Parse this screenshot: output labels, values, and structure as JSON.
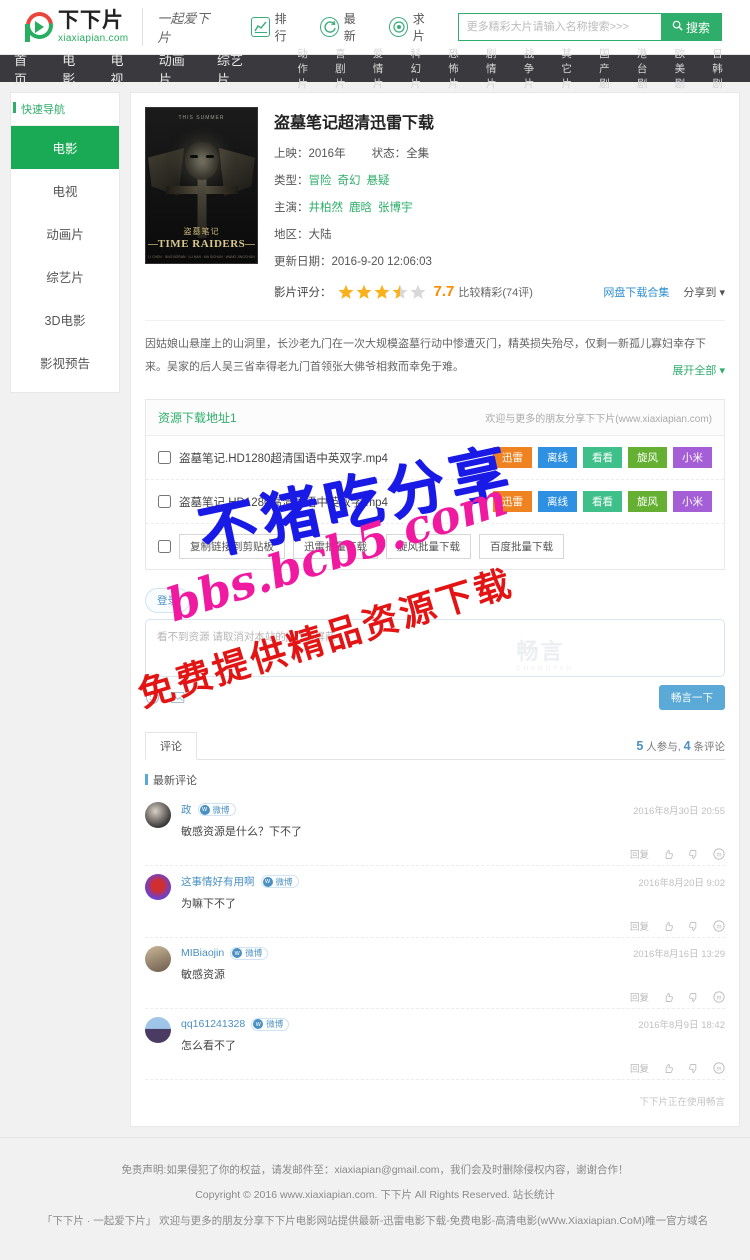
{
  "header": {
    "logo_cn": "下下片",
    "logo_en": "xiaxiapian.com",
    "slogan": "一起爱下片",
    "links": [
      {
        "label": "排行",
        "icon": "chart-icon"
      },
      {
        "label": "最新",
        "icon": "refresh-icon"
      },
      {
        "label": "求片",
        "icon": "target-icon"
      }
    ],
    "search": {
      "placeholder": "更多精彩大片请输入名称搜索>>>",
      "value": "",
      "button": "搜索",
      "icon": "search-icon"
    }
  },
  "nav": {
    "main": [
      "首页",
      "电影",
      "电视",
      "动画片",
      "综艺片"
    ],
    "sub": [
      "动作片",
      "喜剧片",
      "爱情片",
      "科幻片",
      "恐怖片",
      "剧情片",
      "战争片",
      "其它片",
      "国产剧",
      "港台剧",
      "欧美剧",
      "日韩剧"
    ]
  },
  "sidebar": {
    "title": "快速导航",
    "items": [
      {
        "label": "电影",
        "active": true
      },
      {
        "label": "电视",
        "active": false
      },
      {
        "label": "动画片",
        "active": false
      },
      {
        "label": "综艺片",
        "active": false
      },
      {
        "label": "3D电影",
        "active": false
      },
      {
        "label": "影视预告",
        "active": false
      }
    ]
  },
  "movie": {
    "title": "盗墓笔记超清迅雷下载",
    "poster": {
      "top_text": "THIS SUMMER",
      "cn_title": "盗墓笔记",
      "en_title": "TIME RAIDERS",
      "credits": "LI CHEN · JING BORAN · LU HAN · MA SICHUN · WANG JINGCHUN"
    },
    "release_label": "上映：",
    "release_value": "2016年",
    "status_label": "状态：",
    "status_value": "全集",
    "genre_label": "类型：",
    "genres": [
      "冒险",
      "奇幻",
      "悬疑"
    ],
    "actor_label": "主演：",
    "actors": [
      "井柏然",
      "鹿晗",
      "张博宇"
    ],
    "area_label": "地区：",
    "area_value": "大陆",
    "update_label": "更新日期：",
    "update_value": "2016-9-20 12:06:03",
    "score_label": "影片评分：",
    "score": "7.7",
    "score_text": "比较精彩(74评)",
    "stars_filled": 3,
    "stars_half": 1,
    "stars_empty": 1,
    "netdisk_link": "网盘下载合集",
    "share_label": "分享到",
    "description": "因姑娘山悬崖上的山洞里，长沙老九门在一次大规模盗墓行动中惨遭灭门，精英损失殆尽，仅剩一新孤儿寡妇幸存下来。吴家的后人吴三省幸得老九门首领张大佛爷相救而幸免于难。",
    "expand_label": "展开全部"
  },
  "download": {
    "title": "资源下载地址1",
    "notice": "欢迎与更多的朋友分享下下片(www.xiaxiapian.com)",
    "files": [
      {
        "name": "盗墓笔记.HD1280超清国语中英双字.mp4",
        "tags": [
          {
            "label": "迅雷",
            "color": "#f08321"
          },
          {
            "label": "离线",
            "color": "#2f8fe0"
          },
          {
            "label": "看看",
            "color": "#3fc08a"
          },
          {
            "label": "旋风",
            "color": "#65b032"
          },
          {
            "label": "小米",
            "color": "#a45fd6"
          }
        ]
      },
      {
        "name": "盗墓笔记.HD1280高清国语中英双字.mp4",
        "tags": [
          {
            "label": "迅雷",
            "color": "#f08321"
          },
          {
            "label": "离线",
            "color": "#2f8fe0"
          },
          {
            "label": "看看",
            "color": "#3fc08a"
          },
          {
            "label": "旋风",
            "color": "#65b032"
          },
          {
            "label": "小米",
            "color": "#a45fd6"
          }
        ]
      }
    ],
    "batch_buttons": [
      "复制链接到剪贴板",
      "迅雷批量下载",
      "旋风批量下载",
      "百度批量下载"
    ]
  },
  "comment_box": {
    "login_label": "登录",
    "placeholder": "看不到资源 请取消对本站的js广告屏蔽",
    "watermark": "畅言",
    "watermark_sub": "CHANGYAN",
    "emoji_icon": "smiley-icon",
    "image_icon": "image-icon",
    "post_button": "畅言一下"
  },
  "comments": {
    "tab_label": "评论",
    "count_people": "5",
    "count_people_suffix": "人参与,",
    "count_comments": "4",
    "count_comments_suffix": "条评论",
    "latest_label": "最新评论",
    "action_reply": "回复",
    "items": [
      {
        "user": "政",
        "badge": "微博",
        "text": "敏感资源是什么？下不了",
        "date": "2016年8月30日 20:55"
      },
      {
        "user": "这事情好有用啊",
        "badge": "微博",
        "text": "为嘛下不了",
        "date": "2016年8月20日 9:02"
      },
      {
        "user": "MIBiaojin",
        "badge": "微博",
        "text": "敏感资源",
        "date": "2016年8月16日 13:29"
      },
      {
        "user": "qq161241328",
        "badge": "微博",
        "text": "怎么看不了",
        "date": "2016年8月9日 18:42"
      }
    ],
    "powered_by": "下下片正在使用畅言"
  },
  "footer": {
    "line1": "免责声明:如果侵犯了你的权益，请发邮件至：xiaxiapian@gmail.com，我们会及时删除侵权内容，谢谢合作！",
    "line2": "Copyright © 2016 www.xiaxiapian.com. 下下片 All Rights Reserved. 站长统计",
    "line3": "「下下片 · 一起爱下片」 欢迎与更多的朋友分享下下片电影网站提供最新-迅雷电影下载-免费电影-高清电影(wWw.Xiaxiapian.CoM)唯一官方域名"
  },
  "watermarks": {
    "blue": "不猪吃分享",
    "pink": "bbs.bcb5.com",
    "red": "免费提供精品资源下载"
  }
}
